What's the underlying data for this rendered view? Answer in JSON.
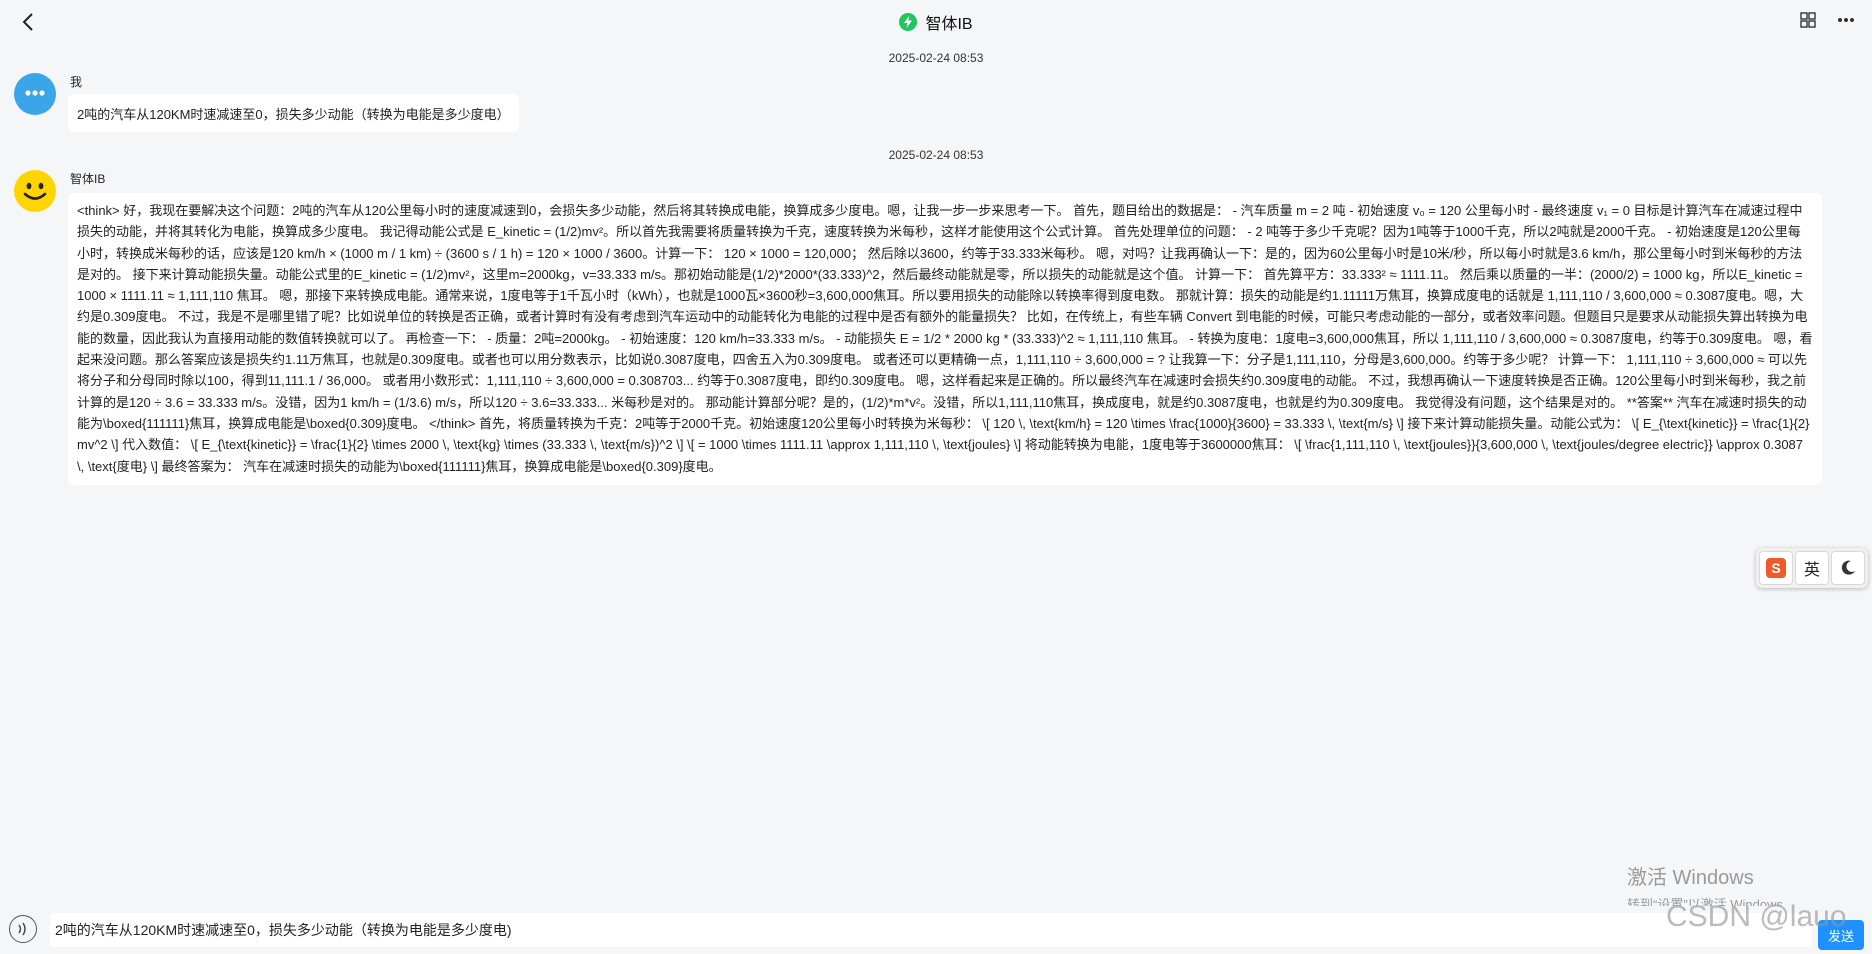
{
  "header": {
    "title": "智体IB",
    "back_icon": "chevron-left-icon",
    "grid_icon": "grid-icon",
    "more_icon": "more-icon",
    "logo_color": "#22c55e"
  },
  "messages": [
    {
      "timestamp": "2025-02-24 08:53",
      "sender": "我",
      "avatar": "chat-bubble-icon",
      "text": "2吨的汽车从120KM时速减速至0，损失多少动能（转换为电能是多少度电）"
    },
    {
      "timestamp": "2025-02-24 08:53",
      "sender": "智体IB",
      "avatar": "smiley-icon",
      "text": "<think> 好，我现在要解决这个问题：2吨的汽车从120公里每小时的速度减速到0，会损失多少动能，然后将其转换成电能，换算成多少度电。嗯，让我一步一步来思考一下。 首先，题目给出的数据是： - 汽车质量 m = 2 吨 - 初始速度 v₀ = 120 公里每小时 - 最终速度 v₁ = 0 目标是计算汽车在减速过程中损失的动能，并将其转化为电能，换算成多少度电。 我记得动能公式是 E_kinetic = (1/2)mv²。所以首先我需要将质量转换为千克，速度转换为米每秒，这样才能使用这个公式计算。 首先处理单位的问题： - 2 吨等于多少千克呢？因为1吨等于1000千克，所以2吨就是2000千克。 - 初始速度是120公里每小时，转换成米每秒的话，应该是120 km/h × (1000 m / 1 km) ÷ (3600 s / 1 h) = 120 × 1000 / 3600。计算一下： 120 × 1000 = 120,000； 然后除以3600，约等于33.333米每秒。 嗯，对吗？让我再确认一下：是的，因为60公里每小时是10米/秒，所以每小时就是3.6 km/h，那公里每小时到米每秒的方法是对的。 接下来计算动能损失量。动能公式里的E_kinetic = (1/2)mv²，这里m=2000kg，v=33.333 m/s。那初始动能是(1/2)*2000*(33.333)^2，然后最终动能就是零，所以损失的动能就是这个值。 计算一下： 首先算平方：33.333² ≈ 1111.11。 然后乘以质量的一半：(2000/2) = 1000 kg，所以E_kinetic = 1000 × 1111.11 ≈ 1,111,110 焦耳。 嗯，那接下来转换成电能。通常来说，1度电等于1千瓦小时（kWh），也就是1000瓦×3600秒=3,600,000焦耳。所以要用损失的动能除以转换率得到度电数。 那就计算：损失的动能是约1.11111万焦耳，换算成度电的话就是 1,111,110 / 3,600,000 ≈ 0.3087度电。嗯，大约是0.309度电。 不过，我是不是哪里错了呢？比如说单位的转换是否正确，或者计算时有没有考虑到汽车运动中的动能转化为电能的过程中是否有额外的能量损失？ 比如，在传统上，有些车辆 Convert 到电能的时候，可能只考虑动能的一部分，或者效率问题。但题目只是要求从动能损失算出转换为电能的数量，因此我认为直接用动能的数值转换就可以了。 再检查一下： - 质量：2吨=2000kg。 - 初始速度：120 km/h=33.333 m/s。 - 动能损失 E = 1/2 * 2000 kg * (33.333)^2 ≈ 1,111,110 焦耳。 - 转换为度电：1度电=3,600,000焦耳，所以 1,111,110 / 3,600,000 ≈ 0.3087度电，约等于0.309度电。 嗯，看起来没问题。那么答案应该是损失约1.11万焦耳，也就是0.309度电。或者也可以用分数表示，比如说0.3087度电，四舍五入为0.309度电。 或者还可以更精确一点，1,111,110 ÷ 3,600,000 = ? 让我算一下：分子是1,111,110，分母是3,600,000。约等于多少呢？ 计算一下： 1,111,110 ÷ 3,600,000 ≈ 可以先将分子和分母同时除以100，得到11,111.1 / 36,000。 或者用小数形式：1,111,110 ÷ 3,600,000 = 0.308703... 约等于0.3087度电，即约0.309度电。 嗯，这样看起来是正确的。所以最终汽车在减速时会损失约0.309度电的动能。 不过，我想再确认一下速度转换是否正确。120公里每小时到米每秒，我之前计算的是120 ÷ 3.6 = 33.333 m/s。没错，因为1 km/h = (1/3.6) m/s，所以120 ÷ 3.6=33.333... 米每秒是对的。 那动能计算部分呢？是的，(1/2)*m*v²。没错，所以1,111,110焦耳，换成度电，就是约0.3087度电，也就是约为0.309度电。 我觉得没有问题，这个结果是对的。 **答案** 汽车在减速时损失的动能为\\boxed{111111}焦耳，换算成电能是\\boxed{0.309}度电。 </think> 首先，将质量转换为千克：2吨等于2000千克。初始速度120公里每小时转换为米每秒： \\[ 120 \\, \\text{km/h} = 120 \\times \\frac{1000}{3600} = 33.333 \\, \\text{m/s} \\] 接下来计算动能损失量。动能公式为： \\[ E_{\\text{kinetic}} = \\frac{1}{2}mv^2 \\] 代入数值： \\[ E_{\\text{kinetic}} = \\frac{1}{2} \\times 2000 \\, \\text{kg} \\times (33.333 \\, \\text{m/s})^2 \\] \\[ = 1000 \\times 1111.11 \\approx 1,111,110 \\, \\text{joules} \\] 将动能转换为电能，1度电等于3600000焦耳： \\[ \\frac{1,111,110 \\, \\text{joules}}{3,600,000 \\, \\text{joules/degree electric}} \\approx 0.3087 \\, \\text{度电} \\] 最终答案为： 汽车在减速时损失的动能为\\boxed{111111}焦耳，换算成电能是\\boxed{0.309}度电。"
    }
  ],
  "floating_toolbar": {
    "brand_icon": "sogou-s-icon",
    "lang_label": "英",
    "moon_icon": "moon-icon"
  },
  "watermark": {
    "windows_title": "激活 Windows",
    "windows_sub": "转到“设置”以激活 Windows。",
    "csdn": "CSDN @lauo"
  },
  "input": {
    "value": "2吨的汽车从120KM时速减速至0，损失多少动能（转换为电能是多少度电)",
    "voice_icon": "voice-icon",
    "send_label": "发送"
  }
}
